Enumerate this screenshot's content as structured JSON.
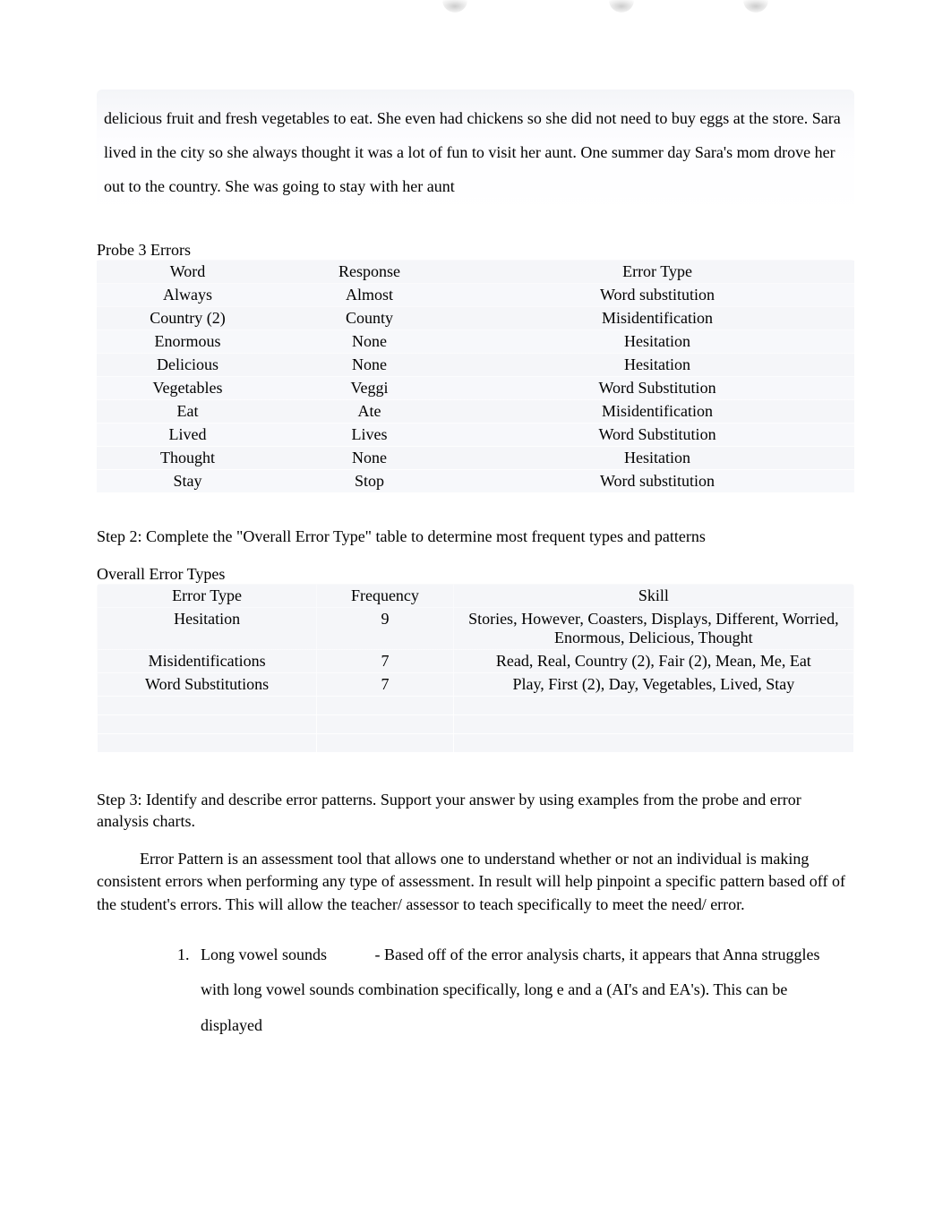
{
  "excerpt_text": "delicious fruit and fresh vegetables to eat. She even had chickens so she did not need to buy eggs at the store. Sara lived in the city so she always thought it was a lot of fun to visit her aunt. One summer day Sara's mom drove her out to the country. She was going to stay with her aunt",
  "probe3": {
    "heading": "Probe 3 Errors",
    "headers": {
      "word": "Word",
      "response": "Response",
      "etype": "Error Type"
    },
    "rows": [
      {
        "word": "Always",
        "response": "Almost",
        "etype": "Word substitution"
      },
      {
        "word": "Country (2)",
        "response": "County",
        "etype": "Misidentification"
      },
      {
        "word": "Enormous",
        "response": "None",
        "etype": "Hesitation"
      },
      {
        "word": "Delicious",
        "response": "None",
        "etype": "Hesitation"
      },
      {
        "word": "Vegetables",
        "response": "Veggi",
        "etype": "Word Substitution"
      },
      {
        "word": "Eat",
        "response": "Ate",
        "etype": "Misidentification"
      },
      {
        "word": "Lived",
        "response": "Lives",
        "etype": "Word Substitution"
      },
      {
        "word": "Thought",
        "response": "None",
        "etype": "Hesitation"
      },
      {
        "word": "Stay",
        "response": "Stop",
        "etype": "Word substitution"
      }
    ]
  },
  "step2_text": "Step 2: Complete the \"Overall Error Type\" table to determine most frequent types and patterns",
  "overall": {
    "heading": "Overall Error Types",
    "headers": {
      "etype": "Error Type",
      "freq": "Frequency",
      "skill": "Skill"
    },
    "rows": [
      {
        "etype": "Hesitation",
        "freq": "9",
        "skill": "Stories, However, Coasters, Displays, Different, Worried, Enormous, Delicious, Thought"
      },
      {
        "etype": "Misidentifications",
        "freq": "7",
        "skill": "Read, Real, Country (2), Fair (2), Mean, Me, Eat"
      },
      {
        "etype": "Word Substitutions",
        "freq": "7",
        "skill": "Play, First (2), Day, Vegetables, Lived, Stay"
      }
    ]
  },
  "step3_text": "Step 3: Identify and describe error patterns. Support your answer by using examples from the probe and error analysis charts.",
  "analysis_para": "Error Pattern is an assessment tool that allows one to understand whether or not an individual is making consistent errors when performing any type of assessment. In result will help pinpoint a specific pattern based off of the student's errors. This will allow the teacher/ assessor to teach specifically to meet the need/ error.",
  "pattern1": {
    "number": "1.",
    "label": "Long vowel sounds",
    "body": "- Based off of the error analysis charts, it appears that Anna struggles with long vowel sounds combination specifically, long e and a (AI's and EA's). This can be displayed"
  }
}
